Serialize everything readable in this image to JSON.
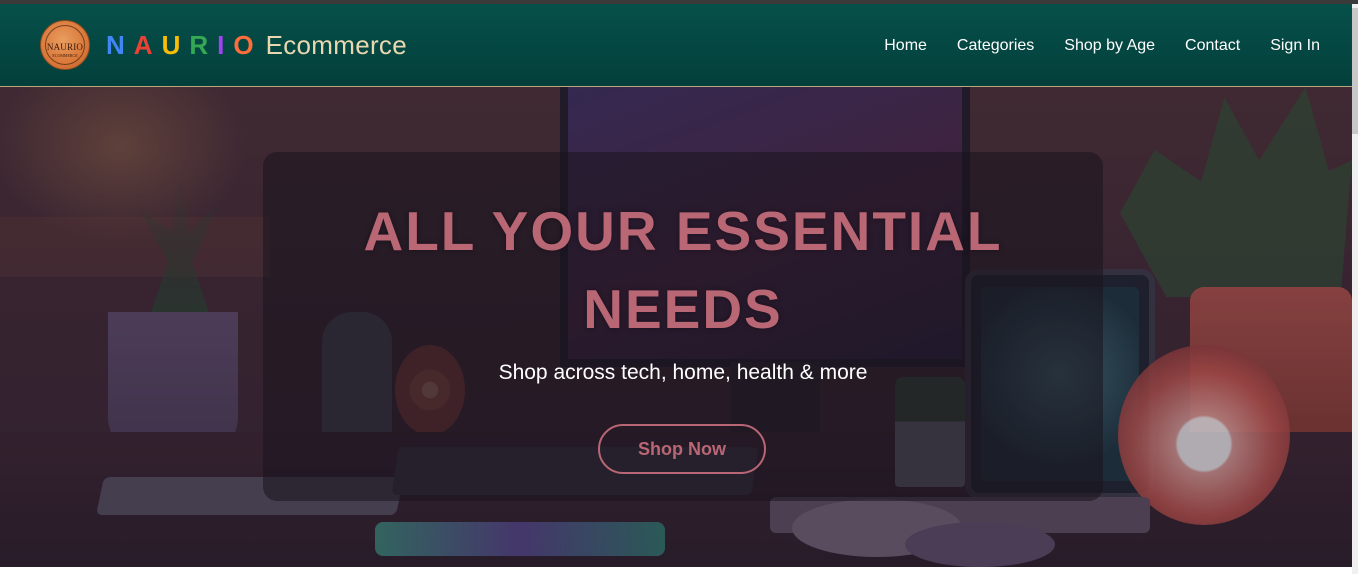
{
  "header": {
    "logo": {
      "text": "NAURIO",
      "subtext": "ECOMMERCE",
      "icon": "naurio-logo-icon"
    },
    "brand": {
      "letters": [
        {
          "char": "N",
          "color": "#4285f4"
        },
        {
          "char": "A",
          "color": "#ea4335"
        },
        {
          "char": "U",
          "color": "#fbbc05"
        },
        {
          "char": "R",
          "color": "#34a853"
        },
        {
          "char": "I",
          "color": "#a142f4"
        },
        {
          "char": "O",
          "color": "#ff6d3a"
        }
      ],
      "suffix": "Ecommerce"
    },
    "nav": {
      "home": "Home",
      "categories": "Categories",
      "shop_by_age": "Shop by Age",
      "contact": "Contact",
      "sign_in": "Sign In"
    },
    "background_color": "#033f3b"
  },
  "hero": {
    "title_line1": "ALL YOUR ESSENTIAL",
    "title_line2": "NEEDS",
    "subtitle": "Shop across tech, home, health & more",
    "cta_label": "Shop Now",
    "accent_color": "#b96675"
  }
}
